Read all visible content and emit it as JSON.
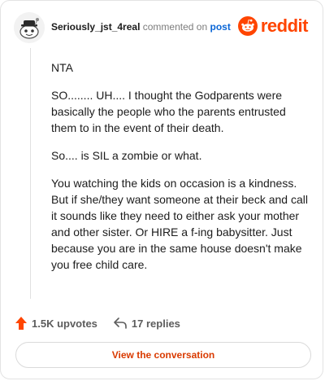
{
  "comment": {
    "author": "Seriously_jst_4real",
    "action_text": "commented on",
    "post_link": "post",
    "paragraphs": [
      "NTA",
      "SO........ UH.... I thought the Godparents were basically the people who the parents entrusted them to in the event of their death.",
      "So.... is SIL a zombie or what.",
      "You watching the kids on occasion is a kindness. But if she/they want someone at their beck and call it sounds like they need to either ask your mother and other sister. Or HIRE a f-ing babysitter. Just because you are in the same house doesn't make you free child care."
    ]
  },
  "brand": {
    "name": "reddit",
    "color": "#ff4500"
  },
  "footer": {
    "upvotes": "1.5K upvotes",
    "replies": "17 replies"
  },
  "cta": {
    "label": "View the conversation"
  },
  "icons": {
    "avatar": "snoo-avatar-icon",
    "logo": "reddit-logo-icon",
    "upvote": "upvote-arrow-icon",
    "reply": "reply-arrow-icon"
  }
}
